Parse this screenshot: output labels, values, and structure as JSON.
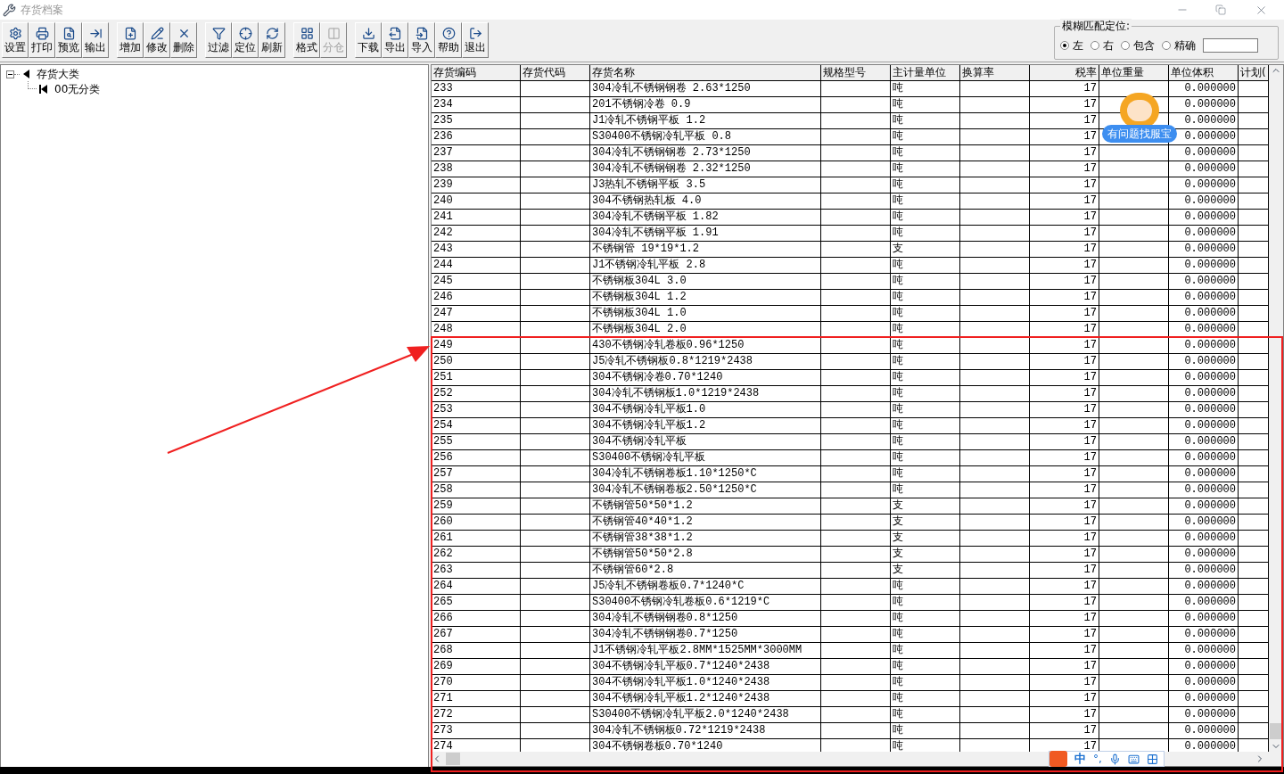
{
  "window": {
    "title": "存货档案"
  },
  "toolbar": {
    "groups": [
      [
        {
          "label": "设置",
          "disabled": false
        },
        {
          "label": "打印",
          "disabled": false
        },
        {
          "label": "预览",
          "disabled": false
        },
        {
          "label": "输出",
          "disabled": false
        }
      ],
      [
        {
          "label": "增加",
          "disabled": false
        },
        {
          "label": "修改",
          "disabled": false
        },
        {
          "label": "删除",
          "disabled": false
        }
      ],
      [
        {
          "label": "过滤",
          "disabled": false
        },
        {
          "label": "定位",
          "disabled": false
        },
        {
          "label": "刷新",
          "disabled": false
        }
      ],
      [
        {
          "label": "格式",
          "disabled": false
        },
        {
          "label": "分仓",
          "disabled": true
        }
      ],
      [
        {
          "label": "下载",
          "disabled": false
        },
        {
          "label": "导出",
          "disabled": false
        },
        {
          "label": "导入",
          "disabled": false
        },
        {
          "label": "帮助",
          "disabled": false
        },
        {
          "label": "退出",
          "disabled": false
        }
      ]
    ]
  },
  "fuzzy_locate": {
    "title": "模糊匹配定位:",
    "options": [
      {
        "label": "左",
        "selected": true
      },
      {
        "label": "右",
        "selected": false
      },
      {
        "label": "包含",
        "selected": false
      },
      {
        "label": "精确",
        "selected": false
      }
    ]
  },
  "tree": [
    {
      "label": "存货大类",
      "expanded": true,
      "children": [
        {
          "label": "00无分类"
        }
      ]
    }
  ],
  "table": {
    "columns": [
      "存货编码",
      "存货代码",
      "存货名称",
      "规格型号",
      "主计量单位",
      "换算率",
      "税率",
      "单位重量",
      "单位体积",
      "计划("
    ],
    "rows": [
      {
        "code": "233",
        "name": "304冷轧不锈钢钢卷 2.63*1250",
        "unit": "吨",
        "tax": "17",
        "volume": "0.000000"
      },
      {
        "code": "234",
        "name": "201不锈钢冷卷 0.9",
        "unit": "吨",
        "tax": "17",
        "volume": "0.000000"
      },
      {
        "code": "235",
        "name": "J1冷轧不锈钢平板 1.2",
        "unit": "吨",
        "tax": "17",
        "volume": "0.000000"
      },
      {
        "code": "236",
        "name": "S30400不锈钢冷轧平板 0.8",
        "unit": "吨",
        "tax": "17",
        "volume": "0.000000"
      },
      {
        "code": "237",
        "name": "304冷轧不锈钢钢卷 2.73*1250",
        "unit": "吨",
        "tax": "17",
        "volume": "0.000000"
      },
      {
        "code": "238",
        "name": "304冷轧不锈钢钢卷 2.32*1250",
        "unit": "吨",
        "tax": "17",
        "volume": "0.000000"
      },
      {
        "code": "239",
        "name": "J3热轧不锈钢平板 3.5",
        "unit": "吨",
        "tax": "17",
        "volume": "0.000000"
      },
      {
        "code": "240",
        "name": "304不锈钢热轧板 4.0",
        "unit": "吨",
        "tax": "17",
        "volume": "0.000000"
      },
      {
        "code": "241",
        "name": "304冷轧不锈钢平板 1.82",
        "unit": "吨",
        "tax": "17",
        "volume": "0.000000"
      },
      {
        "code": "242",
        "name": "304冷轧不锈钢平板 1.91",
        "unit": "吨",
        "tax": "17",
        "volume": "0.000000"
      },
      {
        "code": "243",
        "name": "不锈钢管 19*19*1.2",
        "unit": "支",
        "tax": "17",
        "volume": "0.000000"
      },
      {
        "code": "244",
        "name": "J1不锈钢冷轧平板 2.8",
        "unit": "吨",
        "tax": "17",
        "volume": "0.000000"
      },
      {
        "code": "245",
        "name": "不锈钢板304L 3.0",
        "unit": "吨",
        "tax": "17",
        "volume": "0.000000"
      },
      {
        "code": "246",
        "name": "不锈钢板304L 1.2",
        "unit": "吨",
        "tax": "17",
        "volume": "0.000000"
      },
      {
        "code": "247",
        "name": "不锈钢板304L 1.0",
        "unit": "吨",
        "tax": "17",
        "volume": "0.000000"
      },
      {
        "code": "248",
        "name": "不锈钢板304L 2.0",
        "unit": "吨",
        "tax": "17",
        "volume": "0.000000"
      },
      {
        "code": "249",
        "name": "430不锈钢冷轧卷板0.96*1250",
        "unit": "吨",
        "tax": "17",
        "volume": "0.000000"
      },
      {
        "code": "250",
        "name": "J5冷轧不锈钢板0.8*1219*2438",
        "unit": "吨",
        "tax": "17",
        "volume": "0.000000"
      },
      {
        "code": "251",
        "name": "304不锈钢冷卷0.70*1240",
        "unit": "吨",
        "tax": "17",
        "volume": "0.000000"
      },
      {
        "code": "252",
        "name": "304冷轧不锈钢板1.0*1219*2438",
        "unit": "吨",
        "tax": "17",
        "volume": "0.000000"
      },
      {
        "code": "253",
        "name": "304不锈钢冷轧平板1.0",
        "unit": "吨",
        "tax": "17",
        "volume": "0.000000"
      },
      {
        "code": "254",
        "name": "304不锈钢冷轧平板1.2",
        "unit": "吨",
        "tax": "17",
        "volume": "0.000000"
      },
      {
        "code": "255",
        "name": "304不锈钢冷轧平板",
        "unit": "吨",
        "tax": "17",
        "volume": "0.000000"
      },
      {
        "code": "256",
        "name": "S30400不锈钢冷轧平板",
        "unit": "吨",
        "tax": "17",
        "volume": "0.000000"
      },
      {
        "code": "257",
        "name": "304冷轧不锈钢卷板1.10*1250*C",
        "unit": "吨",
        "tax": "17",
        "volume": "0.000000"
      },
      {
        "code": "258",
        "name": "304冷轧不锈钢卷板2.50*1250*C",
        "unit": "吨",
        "tax": "17",
        "volume": "0.000000"
      },
      {
        "code": "259",
        "name": "不锈钢管50*50*1.2",
        "unit": "支",
        "tax": "17",
        "volume": "0.000000"
      },
      {
        "code": "260",
        "name": "不锈钢管40*40*1.2",
        "unit": "支",
        "tax": "17",
        "volume": "0.000000"
      },
      {
        "code": "261",
        "name": "不锈钢管38*38*1.2",
        "unit": "支",
        "tax": "17",
        "volume": "0.000000"
      },
      {
        "code": "262",
        "name": "不锈钢管50*50*2.8",
        "unit": "支",
        "tax": "17",
        "volume": "0.000000"
      },
      {
        "code": "263",
        "name": "不锈钢管60*2.8",
        "unit": "支",
        "tax": "17",
        "volume": "0.000000"
      },
      {
        "code": "264",
        "name": "J5冷轧不锈钢卷板0.7*1240*C",
        "unit": "吨",
        "tax": "17",
        "volume": "0.000000"
      },
      {
        "code": "265",
        "name": "S30400不锈钢冷轧卷板0.6*1219*C",
        "unit": "吨",
        "tax": "17",
        "volume": "0.000000"
      },
      {
        "code": "266",
        "name": "304冷轧不锈钢钢卷0.8*1250",
        "unit": "吨",
        "tax": "17",
        "volume": "0.000000"
      },
      {
        "code": "267",
        "name": "304冷轧不锈钢钢卷0.7*1250",
        "unit": "吨",
        "tax": "17",
        "volume": "0.000000"
      },
      {
        "code": "268",
        "name": "J1不锈钢冷轧平板2.8MM*1525MM*3000MM",
        "unit": "吨",
        "tax": "17",
        "volume": "0.000000"
      },
      {
        "code": "269",
        "name": "304不锈钢冷轧平板0.7*1240*2438",
        "unit": "吨",
        "tax": "17",
        "volume": "0.000000"
      },
      {
        "code": "270",
        "name": "304不锈钢冷轧平板1.0*1240*2438",
        "unit": "吨",
        "tax": "17",
        "volume": "0.000000"
      },
      {
        "code": "271",
        "name": "304不锈钢冷轧平板1.2*1240*2438",
        "unit": "吨",
        "tax": "17",
        "volume": "0.000000"
      },
      {
        "code": "272",
        "name": "S30400不锈钢冷轧平板2.0*1240*2438",
        "unit": "吨",
        "tax": "17",
        "volume": "0.000000"
      },
      {
        "code": "273",
        "name": "304冷轧不锈钢板0.72*1219*2438",
        "unit": "吨",
        "tax": "17",
        "volume": "0.000000"
      },
      {
        "code": "274",
        "name": "304不锈钢卷板0.70*1240",
        "unit": "吨",
        "tax": "17",
        "volume": "0.000000"
      }
    ]
  },
  "help_widget": {
    "label": "有问题找服宝"
  },
  "ime_bar": {
    "mode": "中",
    "punct": "°,"
  }
}
